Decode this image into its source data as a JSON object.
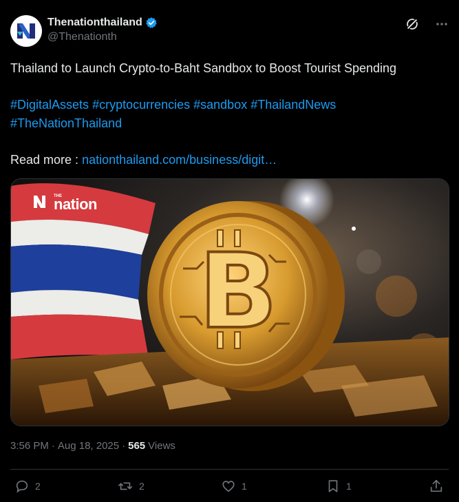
{
  "author": {
    "display_name": "Thenationthailand",
    "handle": "@Thenationth",
    "verified_icon": "verified-badge-icon"
  },
  "post": {
    "headline": "Thailand to Launch Crypto-to-Baht Sandbox to Boost Tourist Spending",
    "hashtags_line1": [
      "#DigitalAssets",
      "#cryptocurrencies",
      "#sandbox",
      "#ThailandNews"
    ],
    "hashtags_line2": [
      "#TheNationThailand"
    ],
    "read_more_label": "Read more :",
    "link_text": "nationthailand.com/business/digit…"
  },
  "media": {
    "logo_small": "THE",
    "logo_text": "nation"
  },
  "meta": {
    "time": "3:56 PM",
    "date": "Aug 18, 2025",
    "views_count": "565",
    "views_label": "Views"
  },
  "actions": {
    "replies": "2",
    "reposts": "2",
    "likes": "1",
    "bookmarks": "1"
  },
  "colors": {
    "accent": "#1d9bf0",
    "muted": "#71767b",
    "text": "#e7e9ea",
    "background": "#000000"
  }
}
